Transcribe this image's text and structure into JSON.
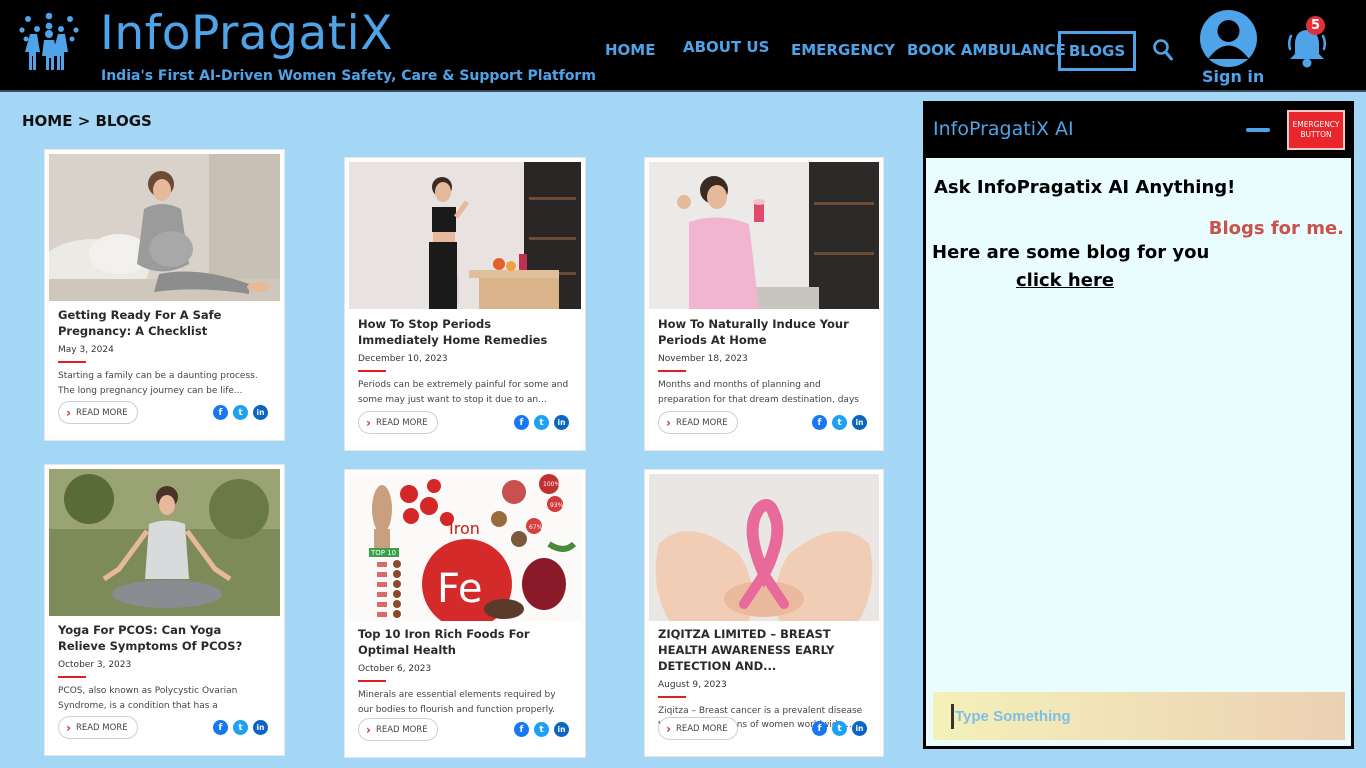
{
  "header": {
    "brand": "InfoPragatiX",
    "tagline": "India's First AI-Driven Women Safety, Care & Support Platform",
    "nav": {
      "home": "HOME",
      "about": "ABOUT US",
      "emergency": "EMERGENCY",
      "ambulance": "BOOK AMBULANCE",
      "blogs": "BLOGS"
    },
    "signin": "Sign in",
    "notification_count": "5",
    "accent_color": "#4fa3e8"
  },
  "breadcrumb": "HOME > BLOGS",
  "cards": [
    {
      "title": "Getting Ready For A Safe Pregnancy: A Checklist",
      "date": "May 3, 2024",
      "excerpt": "Starting a family can be a daunting process. The long pregnancy journey can be life...",
      "read_more": "READ MORE"
    },
    {
      "title": "How To Stop Periods Immediately Home Remedies",
      "date": "December 10, 2023",
      "excerpt": "Periods can be extremely painful for some and some may just want to stop it due to an...",
      "read_more": "READ MORE"
    },
    {
      "title": "How To Naturally Induce Your Periods At Home",
      "date": "November 18, 2023",
      "excerpt": "Months and months of planning and preparation for that dream destination, days g...",
      "read_more": "READ MORE"
    },
    {
      "title": "Yoga For PCOS: Can Yoga Relieve Symptoms Of PCOS?",
      "date": "October 3, 2023",
      "excerpt": "PCOS, also known as Polycystic Ovarian Syndrome, is a condition that has a significant...",
      "read_more": "READ MORE"
    },
    {
      "title": "Top 10 Iron Rich Foods For Optimal Health",
      "date": "October 6, 2023",
      "excerpt": "Minerals are essential elements required by our bodies to flourish and function properly. One...",
      "read_more": "READ MORE"
    },
    {
      "title": "ZIQITZA LIMITED – BREAST HEALTH AWARENESS EARLY DETECTION AND...",
      "date": "August 9, 2023",
      "excerpt": "Ziqitza – Breast cancer is a prevalent disease that affects millions of women worldwide....",
      "read_more": "READ MORE"
    }
  ],
  "card_images": {
    "iron": {
      "word": "Iron",
      "symbol": "Fe",
      "top10": "TOP 10",
      "p1": "100%",
      "p2": "93%",
      "p3": "67%"
    }
  },
  "ai_panel": {
    "title": "InfoPragatiX AI",
    "emergency_button": "EMERGENCY BUTTON",
    "ask": "Ask InfoPragatix AI Anything!",
    "user_message": "Blogs for me.",
    "reply": "Here are some blog for you",
    "link": "click here",
    "input_placeholder": "Type Something"
  },
  "icons": [
    "women-group-icon",
    "search-icon",
    "user-icon",
    "bell-icon",
    "chevron-right-icon",
    "facebook-icon",
    "twitter-icon",
    "linkedin-icon",
    "minimize-icon"
  ]
}
